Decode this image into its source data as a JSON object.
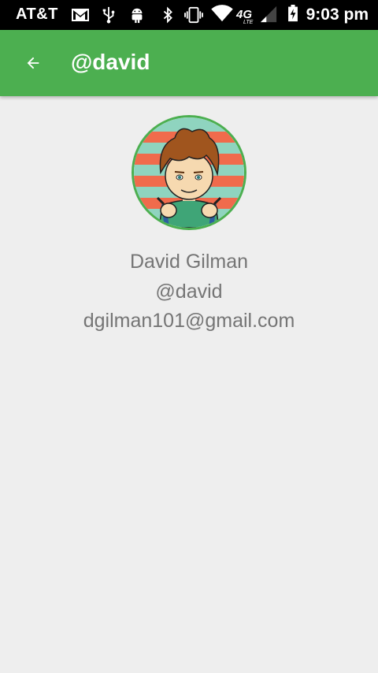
{
  "status_bar": {
    "carrier": "AT&T",
    "network": "4G",
    "network_sub": "LTE",
    "time": "9:03 pm",
    "icons": [
      "gmail-icon",
      "usb-icon",
      "android-icon",
      "bluetooth-icon",
      "vibrate-icon",
      "wifi-icon",
      "signal-icon",
      "battery-charging-icon"
    ]
  },
  "app_bar": {
    "title": "@david",
    "back_icon": "arrow-back-icon",
    "color": "#4caf50"
  },
  "profile": {
    "name": "David Gilman",
    "username": "@david",
    "email": "dgilman101@gmail.com",
    "avatar": "cartoon-avatar"
  }
}
